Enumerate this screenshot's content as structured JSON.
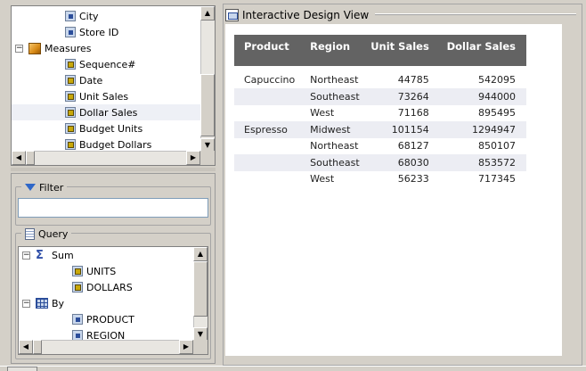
{
  "fields_tree": {
    "items": [
      {
        "label": "City",
        "kind": "dimension",
        "indent": 2
      },
      {
        "label": "Store ID",
        "kind": "dimension",
        "indent": 2
      },
      {
        "label": "Measures",
        "kind": "folder",
        "indent": 1,
        "expander": "−"
      },
      {
        "label": "Sequence#",
        "kind": "measure",
        "indent": 2
      },
      {
        "label": "Date",
        "kind": "measure",
        "indent": 2
      },
      {
        "label": "Unit Sales",
        "kind": "measure",
        "indent": 2
      },
      {
        "label": "Dollar Sales",
        "kind": "measure",
        "indent": 2,
        "selected": true
      },
      {
        "label": "Budget Units",
        "kind": "measure",
        "indent": 2
      },
      {
        "label": "Budget Dollars",
        "kind": "measure",
        "indent": 2
      }
    ]
  },
  "filter": {
    "label": "Filter",
    "value": ""
  },
  "query": {
    "label": "Query",
    "items": [
      {
        "label": "Sum",
        "kind": "sum",
        "indent": 1,
        "expander": "−"
      },
      {
        "label": "UNITS",
        "kind": "measure",
        "indent": 2
      },
      {
        "label": "DOLLARS",
        "kind": "measure",
        "indent": 2
      },
      {
        "label": "By",
        "kind": "by",
        "indent": 1,
        "expander": "−"
      },
      {
        "label": "PRODUCT",
        "kind": "dimension",
        "indent": 2
      },
      {
        "label": "REGION",
        "kind": "dimension",
        "indent": 2
      }
    ]
  },
  "design_view": {
    "title": "Interactive Design View"
  },
  "report": {
    "headers": [
      "Product",
      "Region",
      "Unit Sales",
      "Dollar Sales"
    ],
    "rows": [
      [
        "Capuccino",
        "Northeast",
        "44785",
        "542095"
      ],
      [
        "",
        "Southeast",
        "73264",
        "944000"
      ],
      [
        "",
        "West",
        "71168",
        "895495"
      ],
      [
        "Espresso",
        "Midwest",
        "101154",
        "1294947"
      ],
      [
        "",
        "Northeast",
        "68127",
        "850107"
      ],
      [
        "",
        "Southeast",
        "68030",
        "853572"
      ],
      [
        "",
        "West",
        "56233",
        "717345"
      ]
    ]
  },
  "colors": {
    "header_bg": "#636363",
    "row_shade": "#ecedf3"
  }
}
